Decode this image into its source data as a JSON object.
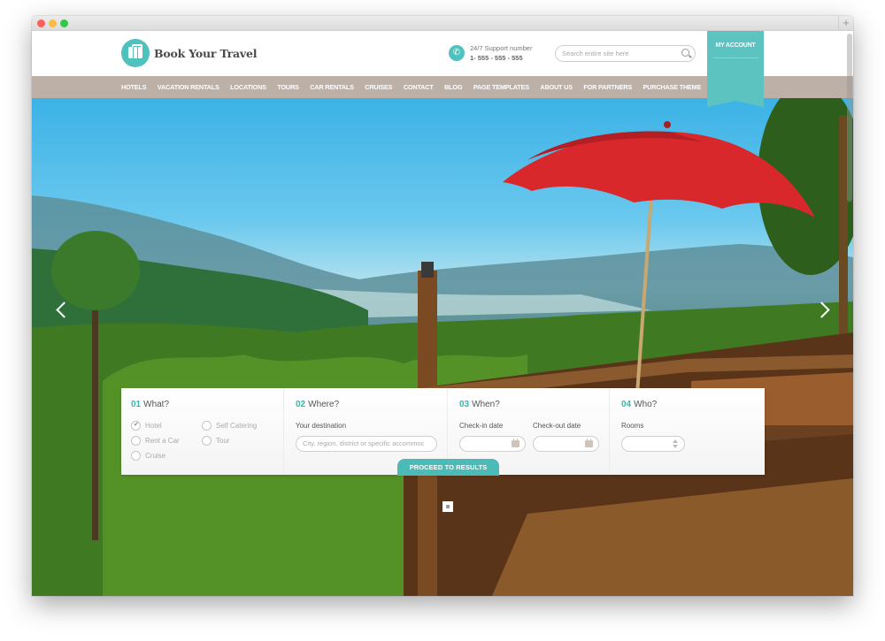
{
  "browser": {
    "controls": [
      "close",
      "minimize",
      "maximize"
    ],
    "new_tab_label": "+"
  },
  "header": {
    "logo_text": "Book Your Travel",
    "support_label": "24/7 Support number",
    "support_number": "1- 555 - 555 - 555",
    "search_placeholder": "Search entire site here",
    "account_label": "MY ACCOUNT"
  },
  "nav": {
    "items": [
      {
        "label": "HOTELS"
      },
      {
        "label": "VACATION RENTALS"
      },
      {
        "label": "LOCATIONS"
      },
      {
        "label": "TOURS"
      },
      {
        "label": "CAR RENTALS"
      },
      {
        "label": "CRUISES"
      },
      {
        "label": "CONTACT"
      },
      {
        "label": "BLOG"
      },
      {
        "label": "PAGE TEMPLATES"
      },
      {
        "label": "ABOUT US"
      },
      {
        "label": "FOR PARTNERS"
      },
      {
        "label": "PURCHASE THEME"
      }
    ]
  },
  "search_form": {
    "what": {
      "num": "01",
      "title": "What?",
      "options": [
        {
          "label": "Hotel",
          "checked": true
        },
        {
          "label": "Self Catering",
          "checked": false
        },
        {
          "label": "Rent a Car",
          "checked": false
        },
        {
          "label": "Tour",
          "checked": false
        },
        {
          "label": "Cruise",
          "checked": false
        }
      ]
    },
    "where": {
      "num": "02",
      "title": "Where?",
      "label": "Your destination",
      "placeholder": "City, region, district or specific accommoc",
      "value": ""
    },
    "when": {
      "num": "03",
      "title": "When?",
      "checkin_label": "Check-in date",
      "checkin_value": "",
      "checkout_label": "Check-out date",
      "checkout_value": ""
    },
    "who": {
      "num": "04",
      "title": "Who?",
      "rooms_label": "Rooms",
      "rooms_value": ""
    },
    "submit_label": "PROCEED TO RESULTS"
  },
  "colors": {
    "accent": "#4fc1bf",
    "nav_bg": "#bdb0a7",
    "ribbon": "#5dc3c1"
  }
}
